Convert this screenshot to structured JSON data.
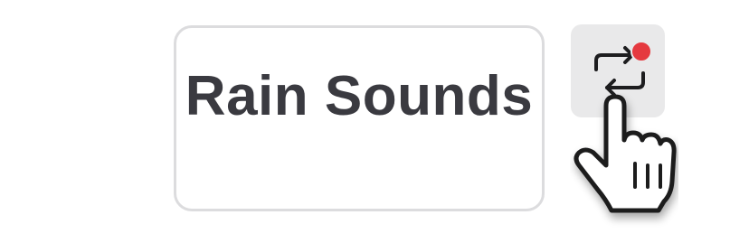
{
  "track": {
    "title": "Rain Sounds"
  },
  "repeat_button": {
    "icon": "repeat-icon",
    "badge": "notification-dot",
    "badge_color": "#e5393f"
  },
  "cursor": {
    "icon": "pointing-hand-cursor-icon"
  },
  "colors": {
    "card_border": "#dcdcde",
    "title_text": "#3a3a40",
    "button_bg": "#e9e9ea"
  }
}
